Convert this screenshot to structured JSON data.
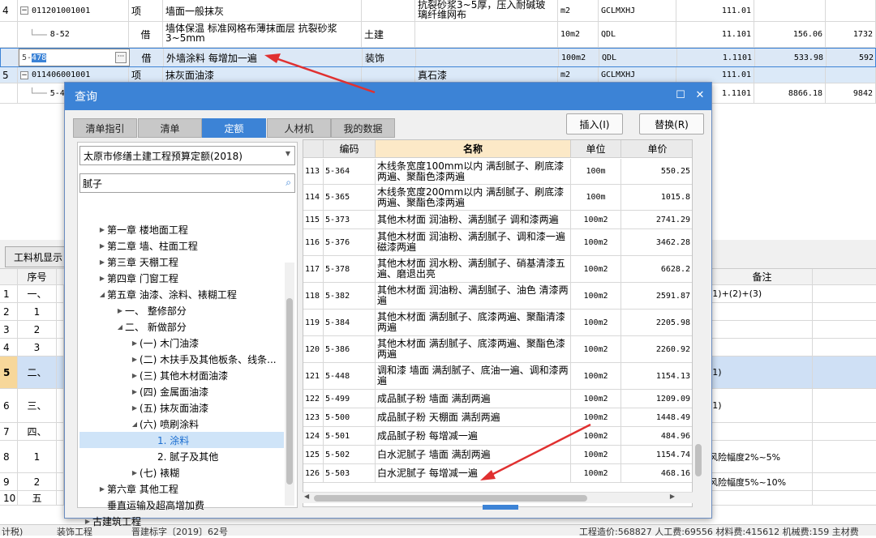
{
  "top_table": {
    "rows": [
      {
        "num": "4",
        "code": "011201001001",
        "type": "项",
        "name": "墙面一般抹灰",
        "feature": "抗裂砂浆3~5厚，压入耐碱玻璃纤维网布",
        "unit": "m2",
        "expr": "GCLMXHJ",
        "qty": "111.01",
        "price": "",
        "total": ""
      },
      {
        "num": "",
        "code": "8-52",
        "type": "借",
        "name": "墙体保温 标准网格布薄抹面层 抗裂砂浆 3~5mm",
        "spec": "土建",
        "unit": "10m2",
        "expr": "QDL",
        "qty": "11.101",
        "price": "156.06",
        "total": "1732"
      },
      {
        "num": "",
        "code": "5-478",
        "type": "借",
        "name": "外墙涂料 每增加一遍",
        "spec": "装饰",
        "unit": "100m2",
        "expr": "QDL",
        "qty": "1.1101",
        "price": "533.98",
        "total": "592"
      },
      {
        "num": "5",
        "code": "011406001001",
        "type": "项",
        "name": "抹灰面油漆",
        "feature": "真石漆",
        "unit": "m2",
        "expr": "GCLMXHJ",
        "qty": "111.01",
        "price": "",
        "total": ""
      },
      {
        "num": "",
        "code": "5-4",
        "type": "",
        "name": "",
        "unit": "",
        "expr": "",
        "qty": "1.1101",
        "price": "8866.18",
        "total": "9842"
      }
    ],
    "more_button": "···"
  },
  "lower": {
    "tab_label": "工料机显示",
    "col_seq": "序号",
    "col_note": "备注",
    "rows": [
      {
        "num": "1",
        "seq": "一、",
        "note": "(1)+(2)+(3)"
      },
      {
        "num": "2",
        "seq": "1",
        "note": ""
      },
      {
        "num": "3",
        "seq": "2",
        "note": ""
      },
      {
        "num": "4",
        "seq": "3",
        "note": ""
      },
      {
        "num": "5",
        "seq": "二、",
        "note": "(1)"
      },
      {
        "num": "6",
        "seq": "三、",
        "note": "(1)"
      },
      {
        "num": "7",
        "seq": "四、",
        "note": ""
      },
      {
        "num": "8",
        "seq": "1",
        "note": "风险幅度2%~5%"
      },
      {
        "num": "9",
        "seq": "2",
        "note": "风险幅度5%~10%"
      },
      {
        "num": "10",
        "seq": "五",
        "note": ""
      }
    ]
  },
  "dialog": {
    "title": "查询",
    "tabs": [
      "清单指引",
      "清单",
      "定额",
      "人材机",
      "我的数据"
    ],
    "insert_label": "插入(I)",
    "replace_label": "替换(R)",
    "quota_lib": "太原市修缮土建工程预算定额(2018)",
    "search_value": "腻子",
    "tree": [
      {
        "label": "第一章 楼地面工程",
        "level": 1,
        "arrow": "▶"
      },
      {
        "label": "第二章 墙、柱面工程",
        "level": 1,
        "arrow": "▶"
      },
      {
        "label": "第三章 天棚工程",
        "level": 1,
        "arrow": "▶"
      },
      {
        "label": "第四章 门窗工程",
        "level": 1,
        "arrow": "▶"
      },
      {
        "label": "第五章 油漆、涂料、裱糊工程",
        "level": 1,
        "arrow": "◢"
      },
      {
        "label": "一、 整修部分",
        "level": 2,
        "arrow": "▶"
      },
      {
        "label": "二、 新做部分",
        "level": 2,
        "arrow": "◢"
      },
      {
        "label": "(一) 木门油漆",
        "level": 3,
        "arrow": "▶"
      },
      {
        "label": "(二) 木扶手及其他板条、线条...",
        "level": 3,
        "arrow": "▶"
      },
      {
        "label": "(三) 其他木材面油漆",
        "level": 3,
        "arrow": "▶"
      },
      {
        "label": "(四) 金属面油漆",
        "level": 3,
        "arrow": "▶"
      },
      {
        "label": "(五) 抹灰面油漆",
        "level": 3,
        "arrow": "▶"
      },
      {
        "label": "(六) 喷刷涂料",
        "level": 3,
        "arrow": "◢"
      },
      {
        "label": "1. 涂料",
        "level": 4,
        "arrow": ""
      },
      {
        "label": "2. 腻子及其他",
        "level": 4,
        "arrow": ""
      },
      {
        "label": "(七) 裱糊",
        "level": 3,
        "arrow": "▶"
      },
      {
        "label": "第六章 其他工程",
        "level": 1,
        "arrow": "▶"
      },
      {
        "label": "垂直运输及超高增加费",
        "level": 1,
        "arrow": ""
      },
      {
        "label": "古建筑工程",
        "level": 0,
        "arrow": "▶"
      }
    ],
    "grid_headers": {
      "code": "编码",
      "name": "名称",
      "unit": "单位",
      "price": "单价"
    },
    "grid_rows": [
      {
        "idx": "113",
        "code": "5-364",
        "name": "木线条宽度100mm以内 满刮腻子、刷底漆两遍、聚酯色漆两遍",
        "unit": "100m",
        "price": "550.25"
      },
      {
        "idx": "114",
        "code": "5-365",
        "name": "木线条宽度200mm以内 满刮腻子、刷底漆两遍、聚酯色漆两遍",
        "unit": "100m",
        "price": "1015.8"
      },
      {
        "idx": "115",
        "code": "5-373",
        "name": "其他木材面 润油粉、满刮腻子 调和漆两遍",
        "unit": "100m2",
        "price": "2741.29"
      },
      {
        "idx": "116",
        "code": "5-376",
        "name": "其他木材面 润油粉、满刮腻子、调和漆一遍磁漆两遍",
        "unit": "100m2",
        "price": "3462.28"
      },
      {
        "idx": "117",
        "code": "5-378",
        "name": "其他木材面 润水粉、满刮腻子、硝基清漆五遍、磨退出亮",
        "unit": "100m2",
        "price": "6628.2"
      },
      {
        "idx": "118",
        "code": "5-382",
        "name": "其他木材面 润油粉、满刮腻子、油色 清漆两遍",
        "unit": "100m2",
        "price": "2591.87"
      },
      {
        "idx": "119",
        "code": "5-384",
        "name": "其他木材面 满刮腻子、底漆两遍、聚酯清漆两遍",
        "unit": "100m2",
        "price": "2205.98"
      },
      {
        "idx": "120",
        "code": "5-386",
        "name": "其他木材面 满刮腻子、底漆两遍、聚酯色漆两遍",
        "unit": "100m2",
        "price": "2260.92"
      },
      {
        "idx": "121",
        "code": "5-448",
        "name": "调和漆 墙面 满刮腻子、底油一遍、调和漆两遍",
        "unit": "100m2",
        "price": "1154.13"
      },
      {
        "idx": "122",
        "code": "5-499",
        "name": "成品腻子粉 墙面 满刮两遍",
        "unit": "100m2",
        "price": "1209.09"
      },
      {
        "idx": "123",
        "code": "5-500",
        "name": "成品腻子粉 天棚面 满刮两遍",
        "unit": "100m2",
        "price": "1448.49"
      },
      {
        "idx": "124",
        "code": "5-501",
        "name": "成品腻子粉 每增减一遍",
        "unit": "100m2",
        "price": "484.96"
      },
      {
        "idx": "125",
        "code": "5-502",
        "name": "白水泥腻子 墙面 满刮两遍",
        "unit": "100m2",
        "price": "1154.74"
      },
      {
        "idx": "126",
        "code": "5-503",
        "name": "白水泥腻子 每增减一遍",
        "unit": "100m2",
        "price": "468.16"
      }
    ]
  },
  "status": {
    "left": "计税)",
    "mid1": "装饰工程",
    "mid2": "晋建标字〔2019〕62号",
    "right": "工程造价:568827  人工费:69556  材料费:415612  机械费:159  主材费"
  },
  "colors": {
    "accent": "#3c83d6",
    "selected_row": "#dce8f6",
    "arrow": "#e03030"
  }
}
